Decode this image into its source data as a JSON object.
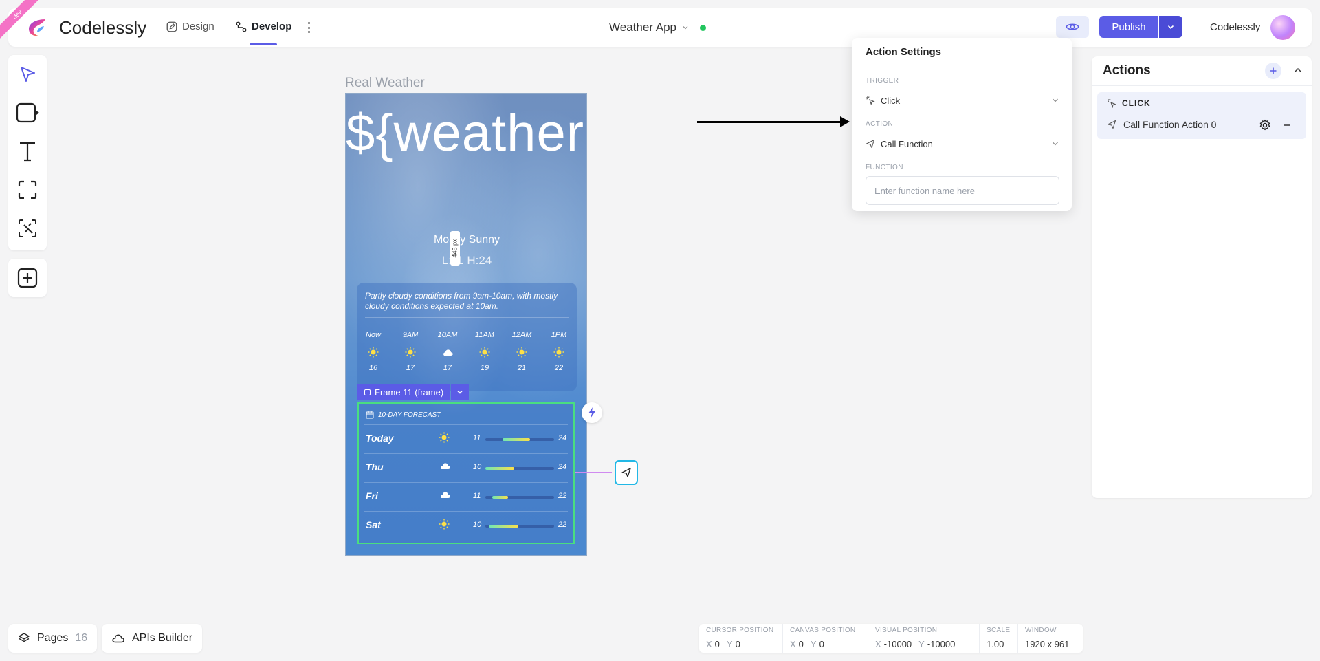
{
  "ribbon": "dev",
  "brand": "Codelessly",
  "nav": {
    "design": "Design",
    "develop": "Develop"
  },
  "project": {
    "name": "Weather App",
    "status_color": "#22c55e"
  },
  "header": {
    "publish": "Publish",
    "account": "Codelessly"
  },
  "canvas": {
    "frame_title": "Real Weather",
    "temp": "${weather.temp}",
    "condition": "Mostly Sunny",
    "lohi": "L:11 H:24",
    "measure": "448 px",
    "summary": "Partly cloudy conditions from 9am-10am, with mostly cloudy conditions expected at 10am.",
    "hours": [
      {
        "time": "Now",
        "icon": "sun-icon",
        "temp": "16"
      },
      {
        "time": "9AM",
        "icon": "sun-icon",
        "temp": "17"
      },
      {
        "time": "10AM",
        "icon": "cloud-icon",
        "temp": "17"
      },
      {
        "time": "11AM",
        "icon": "sun-icon",
        "temp": "19"
      },
      {
        "time": "12AM",
        "icon": "sun-icon",
        "temp": "21"
      },
      {
        "time": "1PM",
        "icon": "sun-icon",
        "temp": "22"
      }
    ],
    "selection_label": "Frame 11 (frame)",
    "forecast_title": "10-DAY FORECAST",
    "forecast": [
      {
        "day": "Today",
        "icon": "sun-icon",
        "lo": "11",
        "hi": "24",
        "range": [
          0.25,
          0.65
        ]
      },
      {
        "day": "Thu",
        "icon": "cloud-icon",
        "lo": "10",
        "hi": "24",
        "range": [
          0.0,
          0.42
        ]
      },
      {
        "day": "Fri",
        "icon": "cloud-icon",
        "lo": "11",
        "hi": "22",
        "range": [
          0.1,
          0.33
        ]
      },
      {
        "day": "Sat",
        "icon": "sun-icon",
        "lo": "10",
        "hi": "22",
        "range": [
          0.05,
          0.48
        ]
      }
    ]
  },
  "action_settings": {
    "title": "Action Settings",
    "trigger_label": "TRIGGER",
    "trigger_value": "Click",
    "action_label": "ACTION",
    "action_value": "Call Function",
    "function_label": "FUNCTION",
    "function_placeholder": "Enter function name here"
  },
  "actions_panel": {
    "title": "Actions",
    "trigger": "CLICK",
    "action": "Call Function Action 0"
  },
  "bottom": {
    "pages_label": "Pages",
    "pages_count": "16",
    "apis": "APIs Builder"
  },
  "statusbar": {
    "cursor": {
      "label": "CURSOR POSITION",
      "x": "0",
      "y": "0"
    },
    "canvas": {
      "label": "CANVAS POSITION",
      "x": "0",
      "y": "0"
    },
    "visual": {
      "label": "VISUAL POSITION",
      "x": "-10000",
      "y": "-10000"
    },
    "scale": {
      "label": "SCALE",
      "value": "1.00"
    },
    "window": {
      "label": "WINDOW",
      "value": "1920 x 961"
    }
  },
  "colors": {
    "accent": "#5b5ce6",
    "selection": "#4ade80",
    "link": "#22b8e6"
  }
}
